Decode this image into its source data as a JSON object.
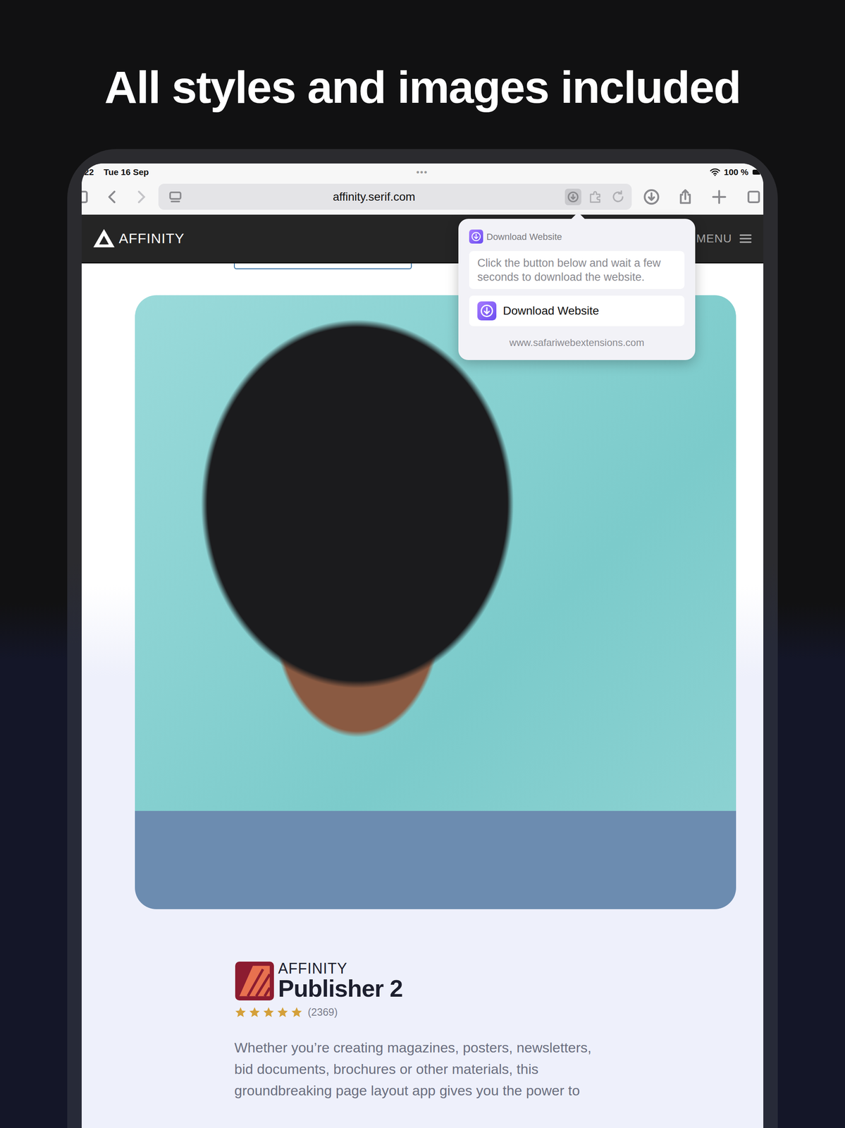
{
  "headline": "All styles and images included",
  "status_bar": {
    "time": "22",
    "date": "Tue 16 Sep",
    "dots": "•••",
    "battery": "100 %"
  },
  "browser": {
    "url": "affinity.serif.com"
  },
  "site": {
    "logo": "AFFINITY",
    "menu": "MENU"
  },
  "popover": {
    "title": "Download Website",
    "hint": "Click the button below and wait a few seconds to download the website.",
    "button": "Download Website",
    "footer": "www.safariwebextensions.com"
  },
  "product": {
    "brand": "AFFINITY",
    "name": "Publisher 2",
    "stars": 5,
    "reviews": "(2369)",
    "description": "Whether you’re creating magazines, posters, newsletters, bid documents, brochures or other materials, this groundbreaking page layout app gives you the power to"
  }
}
